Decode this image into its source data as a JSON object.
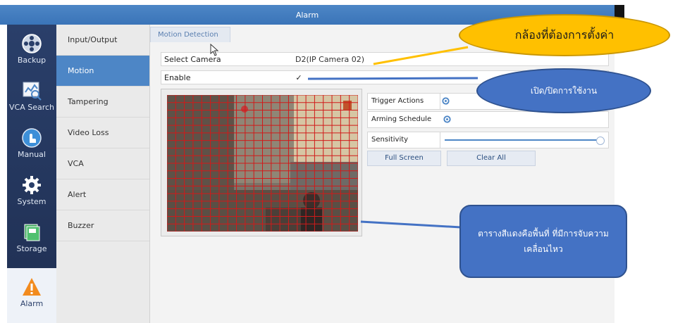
{
  "window": {
    "title": "Alarm"
  },
  "sidebar": {
    "items": [
      {
        "label": "Backup",
        "icon": "backup-icon"
      },
      {
        "label": "VCA Search",
        "icon": "vca-search-icon"
      },
      {
        "label": "Manual",
        "icon": "manual-icon"
      },
      {
        "label": "System",
        "icon": "system-gear-icon"
      },
      {
        "label": "Storage",
        "icon": "storage-icon"
      },
      {
        "label": "Alarm",
        "icon": "alarm-warning-icon",
        "active": true
      }
    ]
  },
  "submenu": {
    "items": [
      {
        "label": "Input/Output"
      },
      {
        "label": "Motion",
        "active": true
      },
      {
        "label": "Tampering"
      },
      {
        "label": "Video Loss"
      },
      {
        "label": "VCA"
      },
      {
        "label": "Alert"
      },
      {
        "label": "Buzzer"
      }
    ]
  },
  "main": {
    "tab": "Motion Detection",
    "select_camera_label": "Select Camera",
    "select_camera_value": "D2(IP Camera 02)",
    "enable_label": "Enable",
    "enable_checked": "✓",
    "trigger_actions_label": "Trigger Actions",
    "arming_schedule_label": "Arming Schedule",
    "sensitivity_label": "Sensitivity",
    "sensitivity_level": 1.0,
    "full_screen_label": "Full Screen",
    "clear_all_label": "Clear All"
  },
  "callouts": {
    "camera_to_configure": "กล้องที่ต้องการตั้งค่า",
    "enable_toggle": "เปิด/ปิดการใช้งาน",
    "grid_explain": "ตารางสีแดงคือพื้นที่ ที่มีการจับความเคลื่อนไหว"
  },
  "colors": {
    "accent": "#4d86c6",
    "callout_yellow": "#ffc000",
    "callout_blue": "#4472c4",
    "grid_red": "#d11a1a"
  }
}
